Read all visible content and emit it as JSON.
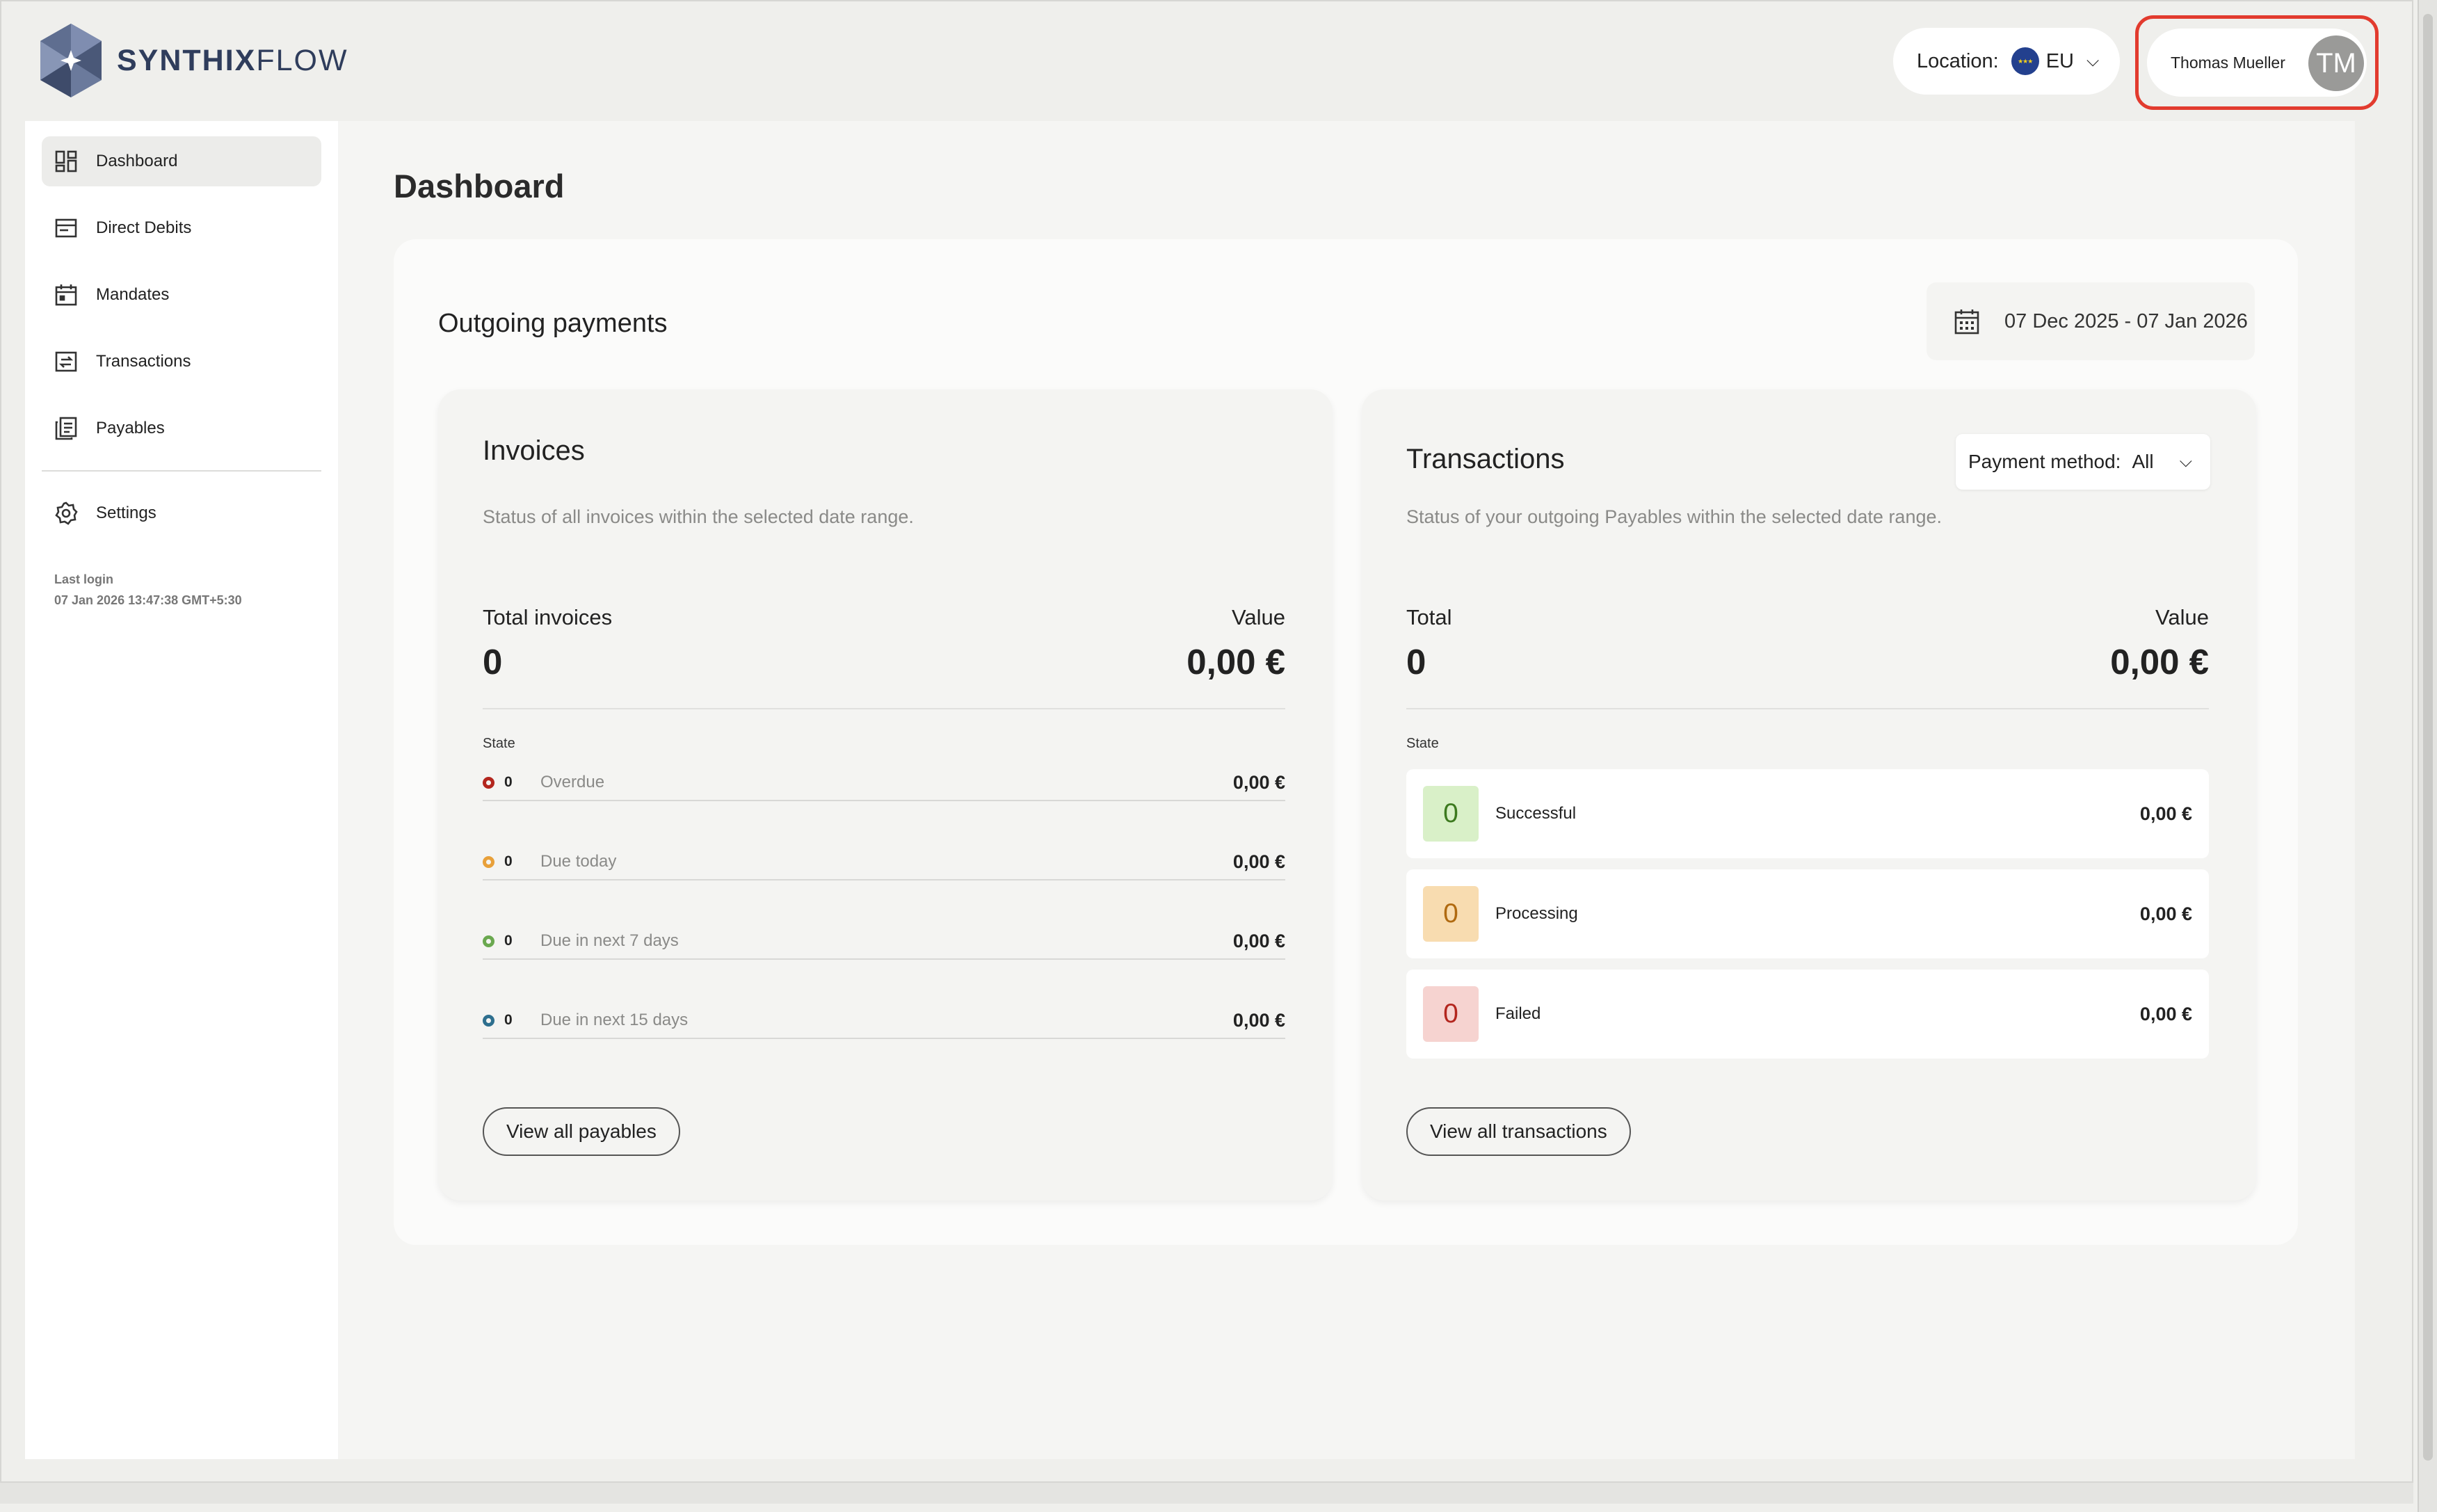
{
  "brand": {
    "part1": "SYNTHIX",
    "part2": "FLOW"
  },
  "header": {
    "location_label": "Location:",
    "location_value": "EU",
    "user_name": "Thomas Mueller",
    "user_initials": "TM"
  },
  "sidebar": {
    "items": [
      {
        "label": "Dashboard",
        "icon": "dashboard-icon",
        "active": true
      },
      {
        "label": "Direct Debits",
        "icon": "direct-debits-icon"
      },
      {
        "label": "Mandates",
        "icon": "calendar-icon"
      },
      {
        "label": "Transactions",
        "icon": "transfer-icon"
      },
      {
        "label": "Payables",
        "icon": "documents-icon"
      }
    ],
    "settings_label": "Settings",
    "last_login_label": "Last login",
    "last_login_value": "07 Jan 2026 13:47:38 GMT+5:30"
  },
  "page": {
    "title": "Dashboard",
    "section_title": "Outgoing payments",
    "date_range": "07 Dec 2025 - 07 Jan 2026"
  },
  "invoices": {
    "title": "Invoices",
    "description": "Status of all invoices within the selected date range.",
    "total_label": "Total invoices",
    "total_value": "0",
    "value_label": "Value",
    "value_amount": "0,00 €",
    "state_label": "State",
    "rows": [
      {
        "count": "0",
        "label": "Overdue",
        "value": "0,00 €",
        "color": "#b3261e"
      },
      {
        "count": "0",
        "label": "Due today",
        "value": "0,00 €",
        "color": "#e8a03a"
      },
      {
        "count": "0",
        "label": "Due in next 7 days",
        "value": "0,00 €",
        "color": "#6aa84f"
      },
      {
        "count": "0",
        "label": "Due in next 15 days",
        "value": "0,00 €",
        "color": "#2e6f8e"
      }
    ],
    "button": "View all payables"
  },
  "transactions": {
    "title": "Transactions",
    "payment_method_label": "Payment method:",
    "payment_method_value": "All",
    "description": "Status of your outgoing Payables within the selected date range.",
    "total_label": "Total",
    "total_value": "0",
    "value_label": "Value",
    "value_amount": "0,00 €",
    "state_label": "State",
    "rows": [
      {
        "count": "0",
        "label": "Successful",
        "value": "0,00 €",
        "bg": "#d9f0c8",
        "fg": "#3d7a1f"
      },
      {
        "count": "0",
        "label": "Processing",
        "value": "0,00 €",
        "bg": "#f8dcb0",
        "fg": "#b06a10"
      },
      {
        "count": "0",
        "label": "Failed",
        "value": "0,00 €",
        "bg": "#f6d3d0",
        "fg": "#b3261e"
      }
    ],
    "button": "View all transactions"
  }
}
